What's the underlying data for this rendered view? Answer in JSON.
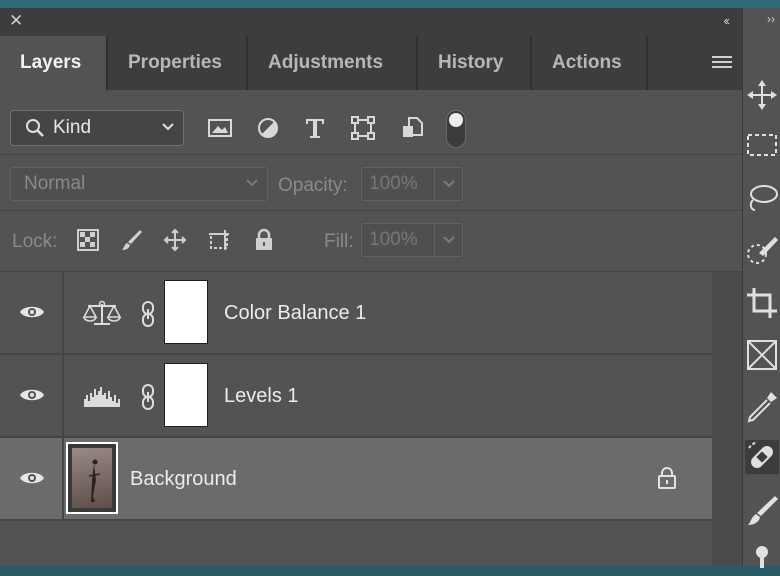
{
  "window": {
    "close_icon": "close-icon",
    "collapse_glyph": "‹‹",
    "toolbar_collapse_glyph": "››"
  },
  "tabs": [
    {
      "label": "Layers",
      "active": true
    },
    {
      "label": "Properties",
      "active": false
    },
    {
      "label": "Adjustments",
      "active": false
    },
    {
      "label": "History",
      "active": false
    },
    {
      "label": "Actions",
      "active": false
    }
  ],
  "filter": {
    "kind_label": "Kind",
    "icons": [
      "image-filter-icon",
      "adjustment-filter-icon",
      "type-filter-icon",
      "shape-filter-icon",
      "smart-object-filter-icon"
    ],
    "filter_toggle": "on"
  },
  "blend": {
    "mode": "Normal",
    "opacity_label": "Opacity:",
    "opacity_value": "100%"
  },
  "lock": {
    "label": "Lock:",
    "icons": [
      "lock-transparent-pixels-icon",
      "lock-image-pixels-icon",
      "lock-position-icon",
      "lock-artboard-icon",
      "lock-all-icon"
    ],
    "fill_label": "Fill:",
    "fill_value": "100%"
  },
  "layers": [
    {
      "name": "Color Balance 1",
      "type": "adjustment",
      "icon": "color-balance-icon",
      "visible": true,
      "selected": false
    },
    {
      "name": "Levels 1",
      "type": "adjustment",
      "icon": "levels-icon",
      "visible": true,
      "selected": false
    },
    {
      "name": "Background",
      "type": "image",
      "visible": true,
      "selected": true,
      "locked": true
    }
  ],
  "colors": {
    "panel": "#535353",
    "tab_bar": "#3d3d3d",
    "selected_layer": "#6b6b6b",
    "canvas": "#2a5a66"
  },
  "toolbar": [
    "move-tool-icon",
    "marquee-tool-icon",
    "lasso-tool-icon",
    "quick-selection-tool-icon",
    "crop-tool-icon",
    "frame-tool-icon",
    "eyedropper-tool-icon",
    "healing-brush-tool-icon",
    "brush-tool-icon",
    "clone-stamp-tool-icon"
  ]
}
